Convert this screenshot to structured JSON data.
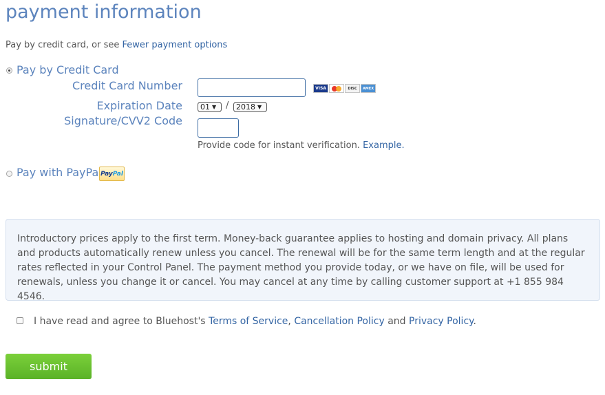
{
  "header": {
    "title": "payment information",
    "subtitle_prefix": "Pay by credit card, or see",
    "subtitle_link": "Fewer payment options"
  },
  "payment_methods": {
    "credit_card": {
      "label": "Pay by Credit Card",
      "selected": true,
      "card_number_label": "Credit Card Number",
      "card_number_value": "",
      "card_brands": {
        "visa": "VISA",
        "mastercard": "MasterCard",
        "discover": "DISCOVER",
        "amex": "AMEX"
      },
      "expiration_label": "Expiration Date",
      "exp_month": "01",
      "exp_separator": "/",
      "exp_year": "2018",
      "cvv_label": "Signature/CVV2 Code",
      "cvv_value": "",
      "hint_text": "Provide code for instant verification.",
      "hint_link": "Example."
    },
    "paypal": {
      "label": "Pay with PayPal",
      "selected": false,
      "badge_pay": "Pay",
      "badge_pal": "Pal"
    }
  },
  "notice": {
    "text": "Introductory prices apply to the first term. Money-back guarantee applies to hosting and domain privacy. All plans and products automatically renew unless you cancel. The renewal will be for the same term length and at the regular rates reflected in your Control Panel. The payment method you provide today, or we have on file, will be used for renewals, unless you change it or cancel. You may cancel at any time by calling customer support at +1 855 984 4546."
  },
  "agreement": {
    "checked": false,
    "prefix": "I have read and agree to Bluehost's",
    "terms_link": "Terms of Service",
    "comma": ",",
    "cancellation_link": "Cancellation Policy",
    "and": "and",
    "privacy_link": "Privacy Policy",
    "suffix": "."
  },
  "actions": {
    "submit_label": "submit"
  },
  "colors": {
    "heading_blue": "#5c84bd",
    "link_blue": "#3465a4",
    "submit_green": "#6cc234",
    "notice_bg": "#f1f5fb"
  }
}
